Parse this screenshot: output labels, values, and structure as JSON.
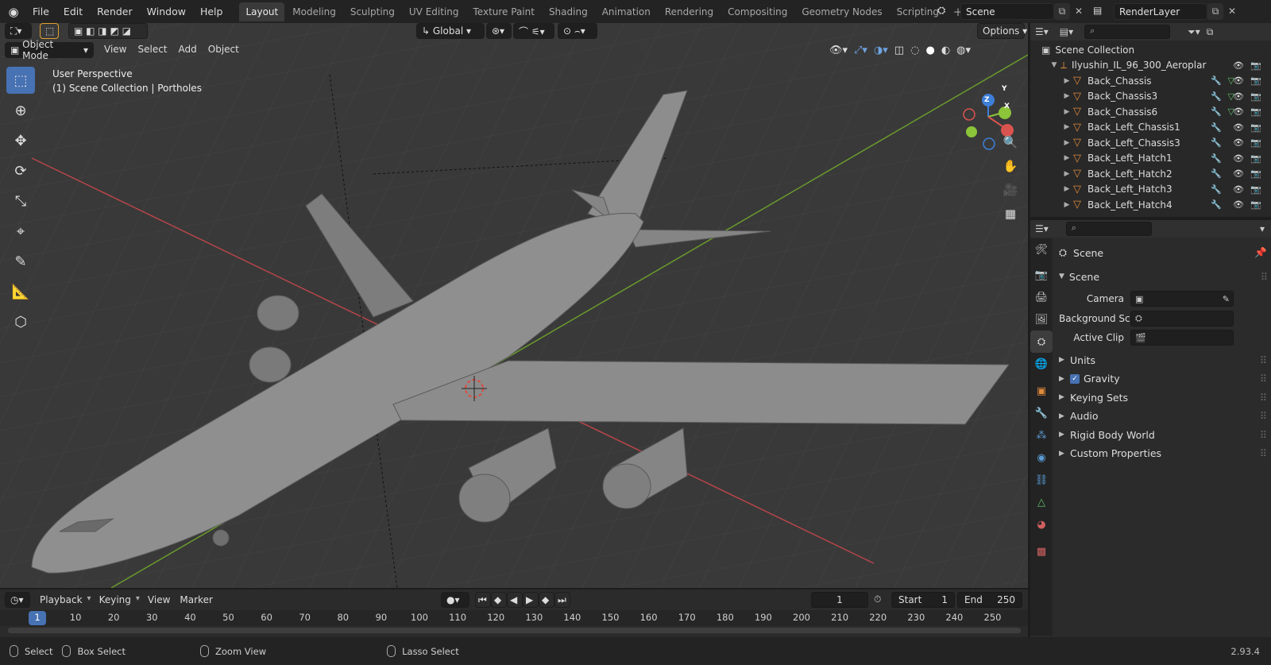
{
  "topbar": {
    "menus": [
      "File",
      "Edit",
      "Render",
      "Window",
      "Help"
    ],
    "workspaces": [
      "Layout",
      "Modeling",
      "Sculpting",
      "UV Editing",
      "Texture Paint",
      "Shading",
      "Animation",
      "Rendering",
      "Compositing",
      "Geometry Nodes",
      "Scripting"
    ],
    "active_workspace": "Layout",
    "scene": "Scene",
    "view_layer": "RenderLayer"
  },
  "viewport": {
    "mode": "Object Mode",
    "menus": [
      "View",
      "Select",
      "Add",
      "Object"
    ],
    "transform_orientation": "Global",
    "options_label": "Options",
    "perspective": "User Perspective",
    "collection_info": "(1) Scene Collection | Portholes",
    "gizmo_axes": [
      "Z",
      "Y",
      "X"
    ]
  },
  "outliner": {
    "root": "Scene Collection",
    "parent": "Ilyushin_IL_96_300_Aeroplar",
    "items": [
      "Back_Chassis",
      "Back_Chassis3",
      "Back_Chassis6",
      "Back_Left_Chassis1",
      "Back_Left_Chassis3",
      "Back_Left_Hatch1",
      "Back_Left_Hatch2",
      "Back_Left_Hatch3",
      "Back_Left_Hatch4"
    ]
  },
  "properties": {
    "context": "Scene",
    "panel": "Scene",
    "fields": [
      {
        "label": "Camera",
        "value": ""
      },
      {
        "label": "Background Sce...",
        "value": ""
      },
      {
        "label": "Active Clip",
        "value": ""
      }
    ],
    "sections": [
      "Units",
      "Gravity",
      "Keying Sets",
      "Audio",
      "Rigid Body World",
      "Custom Properties"
    ],
    "gravity_checked": true
  },
  "timeline": {
    "menus": [
      "Playback",
      "Keying",
      "View",
      "Marker"
    ],
    "current_frame": "1",
    "start_label": "Start",
    "start": "1",
    "end_label": "End",
    "end": "250",
    "ticks": [
      "1",
      "10",
      "20",
      "30",
      "40",
      "50",
      "60",
      "70",
      "80",
      "90",
      "100",
      "110",
      "120",
      "130",
      "140",
      "150",
      "160",
      "170",
      "180",
      "190",
      "200",
      "210",
      "220",
      "230",
      "240",
      "250"
    ]
  },
  "statusbar": {
    "select": "Select",
    "box_select": "Box Select",
    "zoom_view": "Zoom View",
    "lasso_select": "Lasso Select",
    "version": "2.93.4"
  },
  "colors": {
    "accent": "#4772b3",
    "viewport_bg": "#393939",
    "axis_x": "#d9534f",
    "axis_y": "#8cc43a",
    "axis_z": "#3d7fd9"
  }
}
